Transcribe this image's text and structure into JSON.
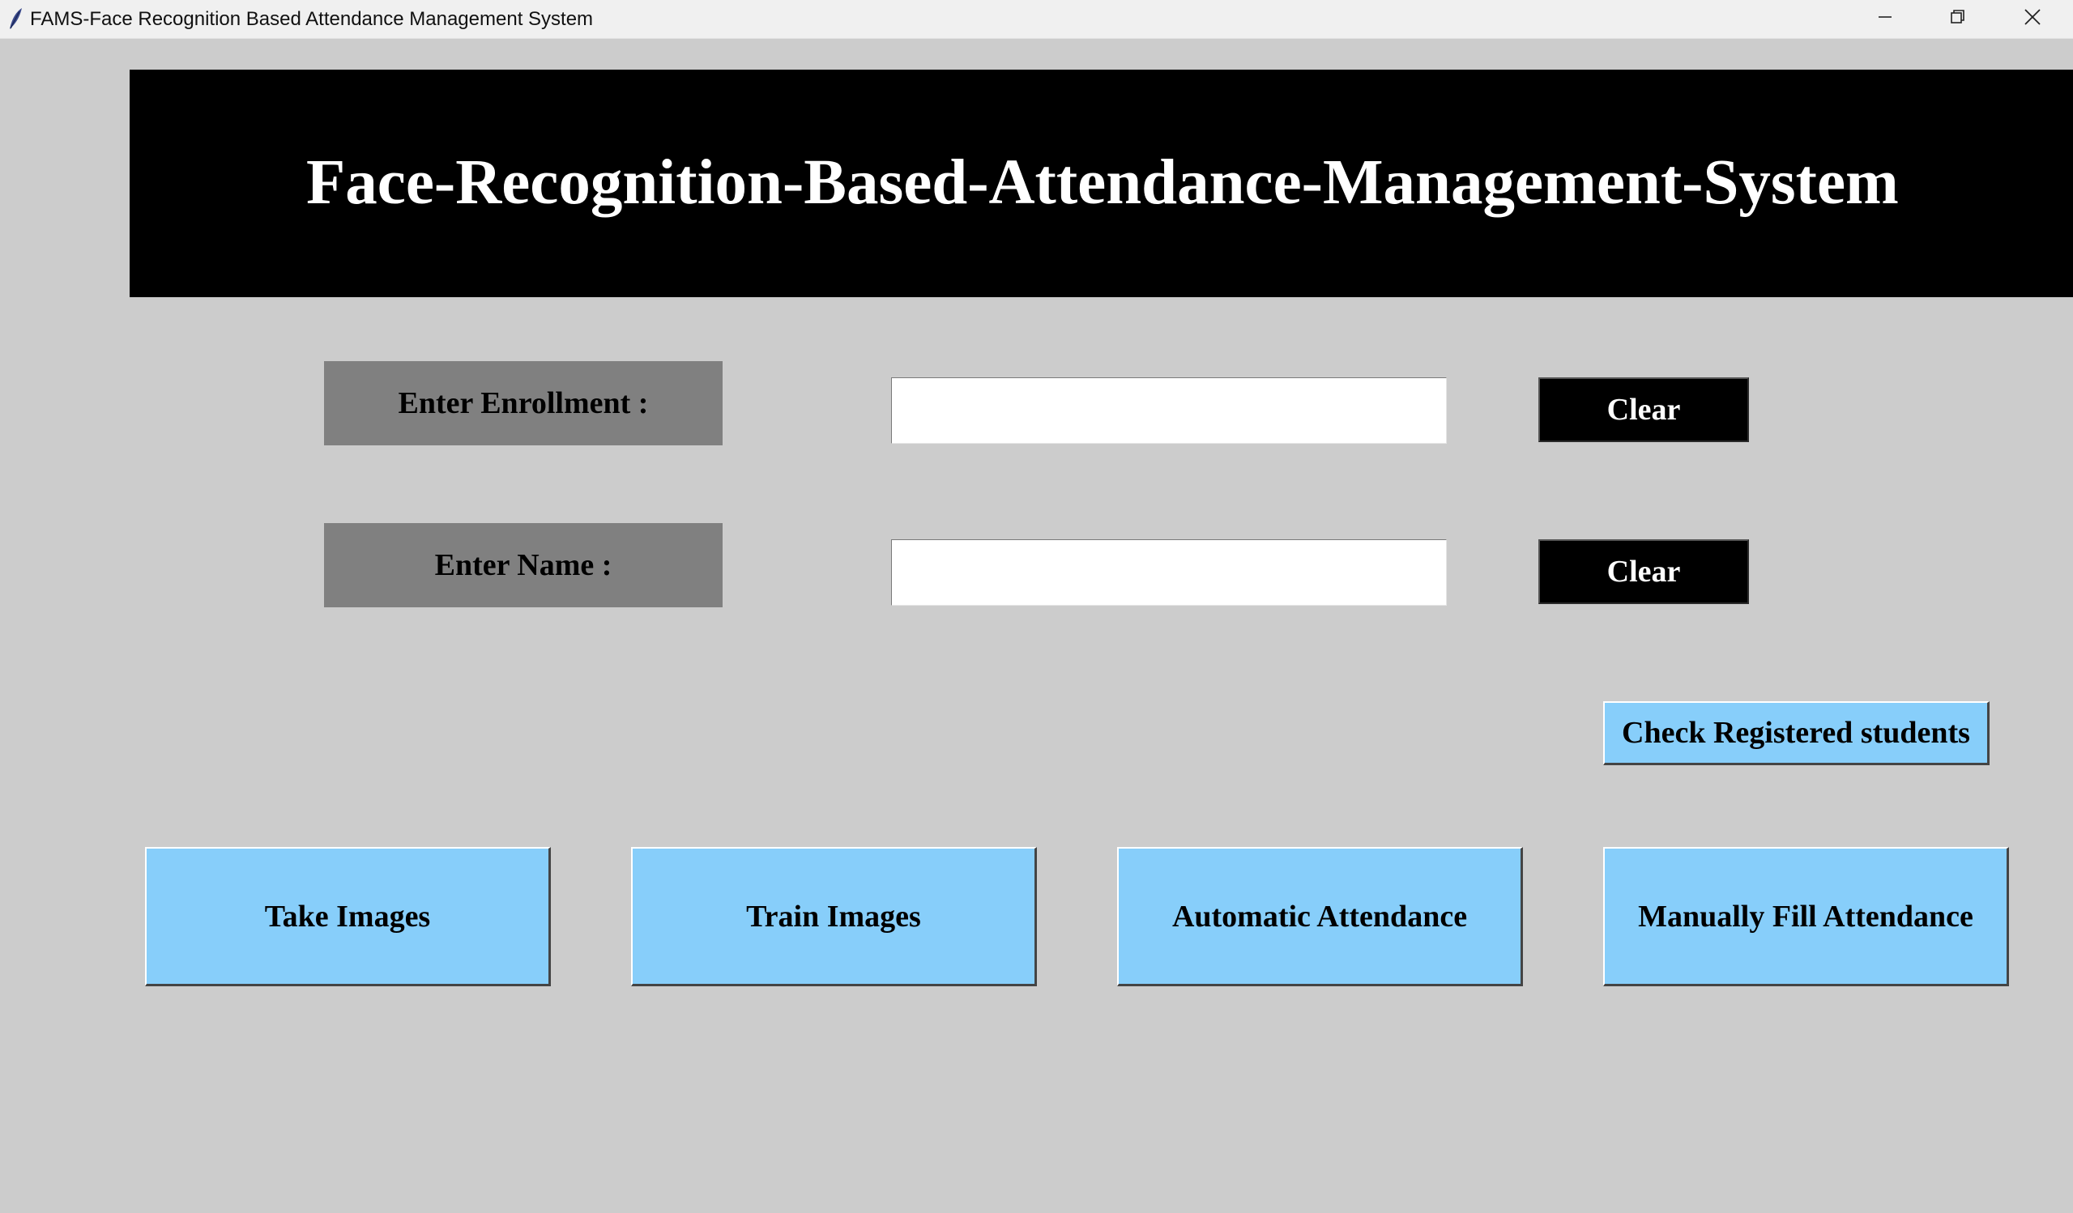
{
  "window": {
    "title": "FAMS-Face Recognition Based Attendance Management System",
    "icon": "feather-icon",
    "controls": {
      "minimize": "minimize-icon",
      "maximize": "restore-icon",
      "close": "close-icon"
    }
  },
  "header": {
    "title": "Face-Recognition-Based-Attendance-Management-System"
  },
  "form": {
    "enrollment": {
      "label": "Enter Enrollment :",
      "value": "",
      "clear_label": "Clear"
    },
    "name": {
      "label": "Enter Name :",
      "value": "",
      "clear_label": "Clear"
    }
  },
  "actions": {
    "check_registered": "Check Registered students",
    "take_images": "Take Images",
    "train_images": "Train Images",
    "automatic_attendance": "Automatic Attendance",
    "manual_attendance": "Manually Fill Attendance"
  },
  "colors": {
    "background": "#cccccc",
    "header_bg": "#000000",
    "header_text": "#ffffff",
    "label_bg": "#808080",
    "action_button": "#87cefa"
  }
}
